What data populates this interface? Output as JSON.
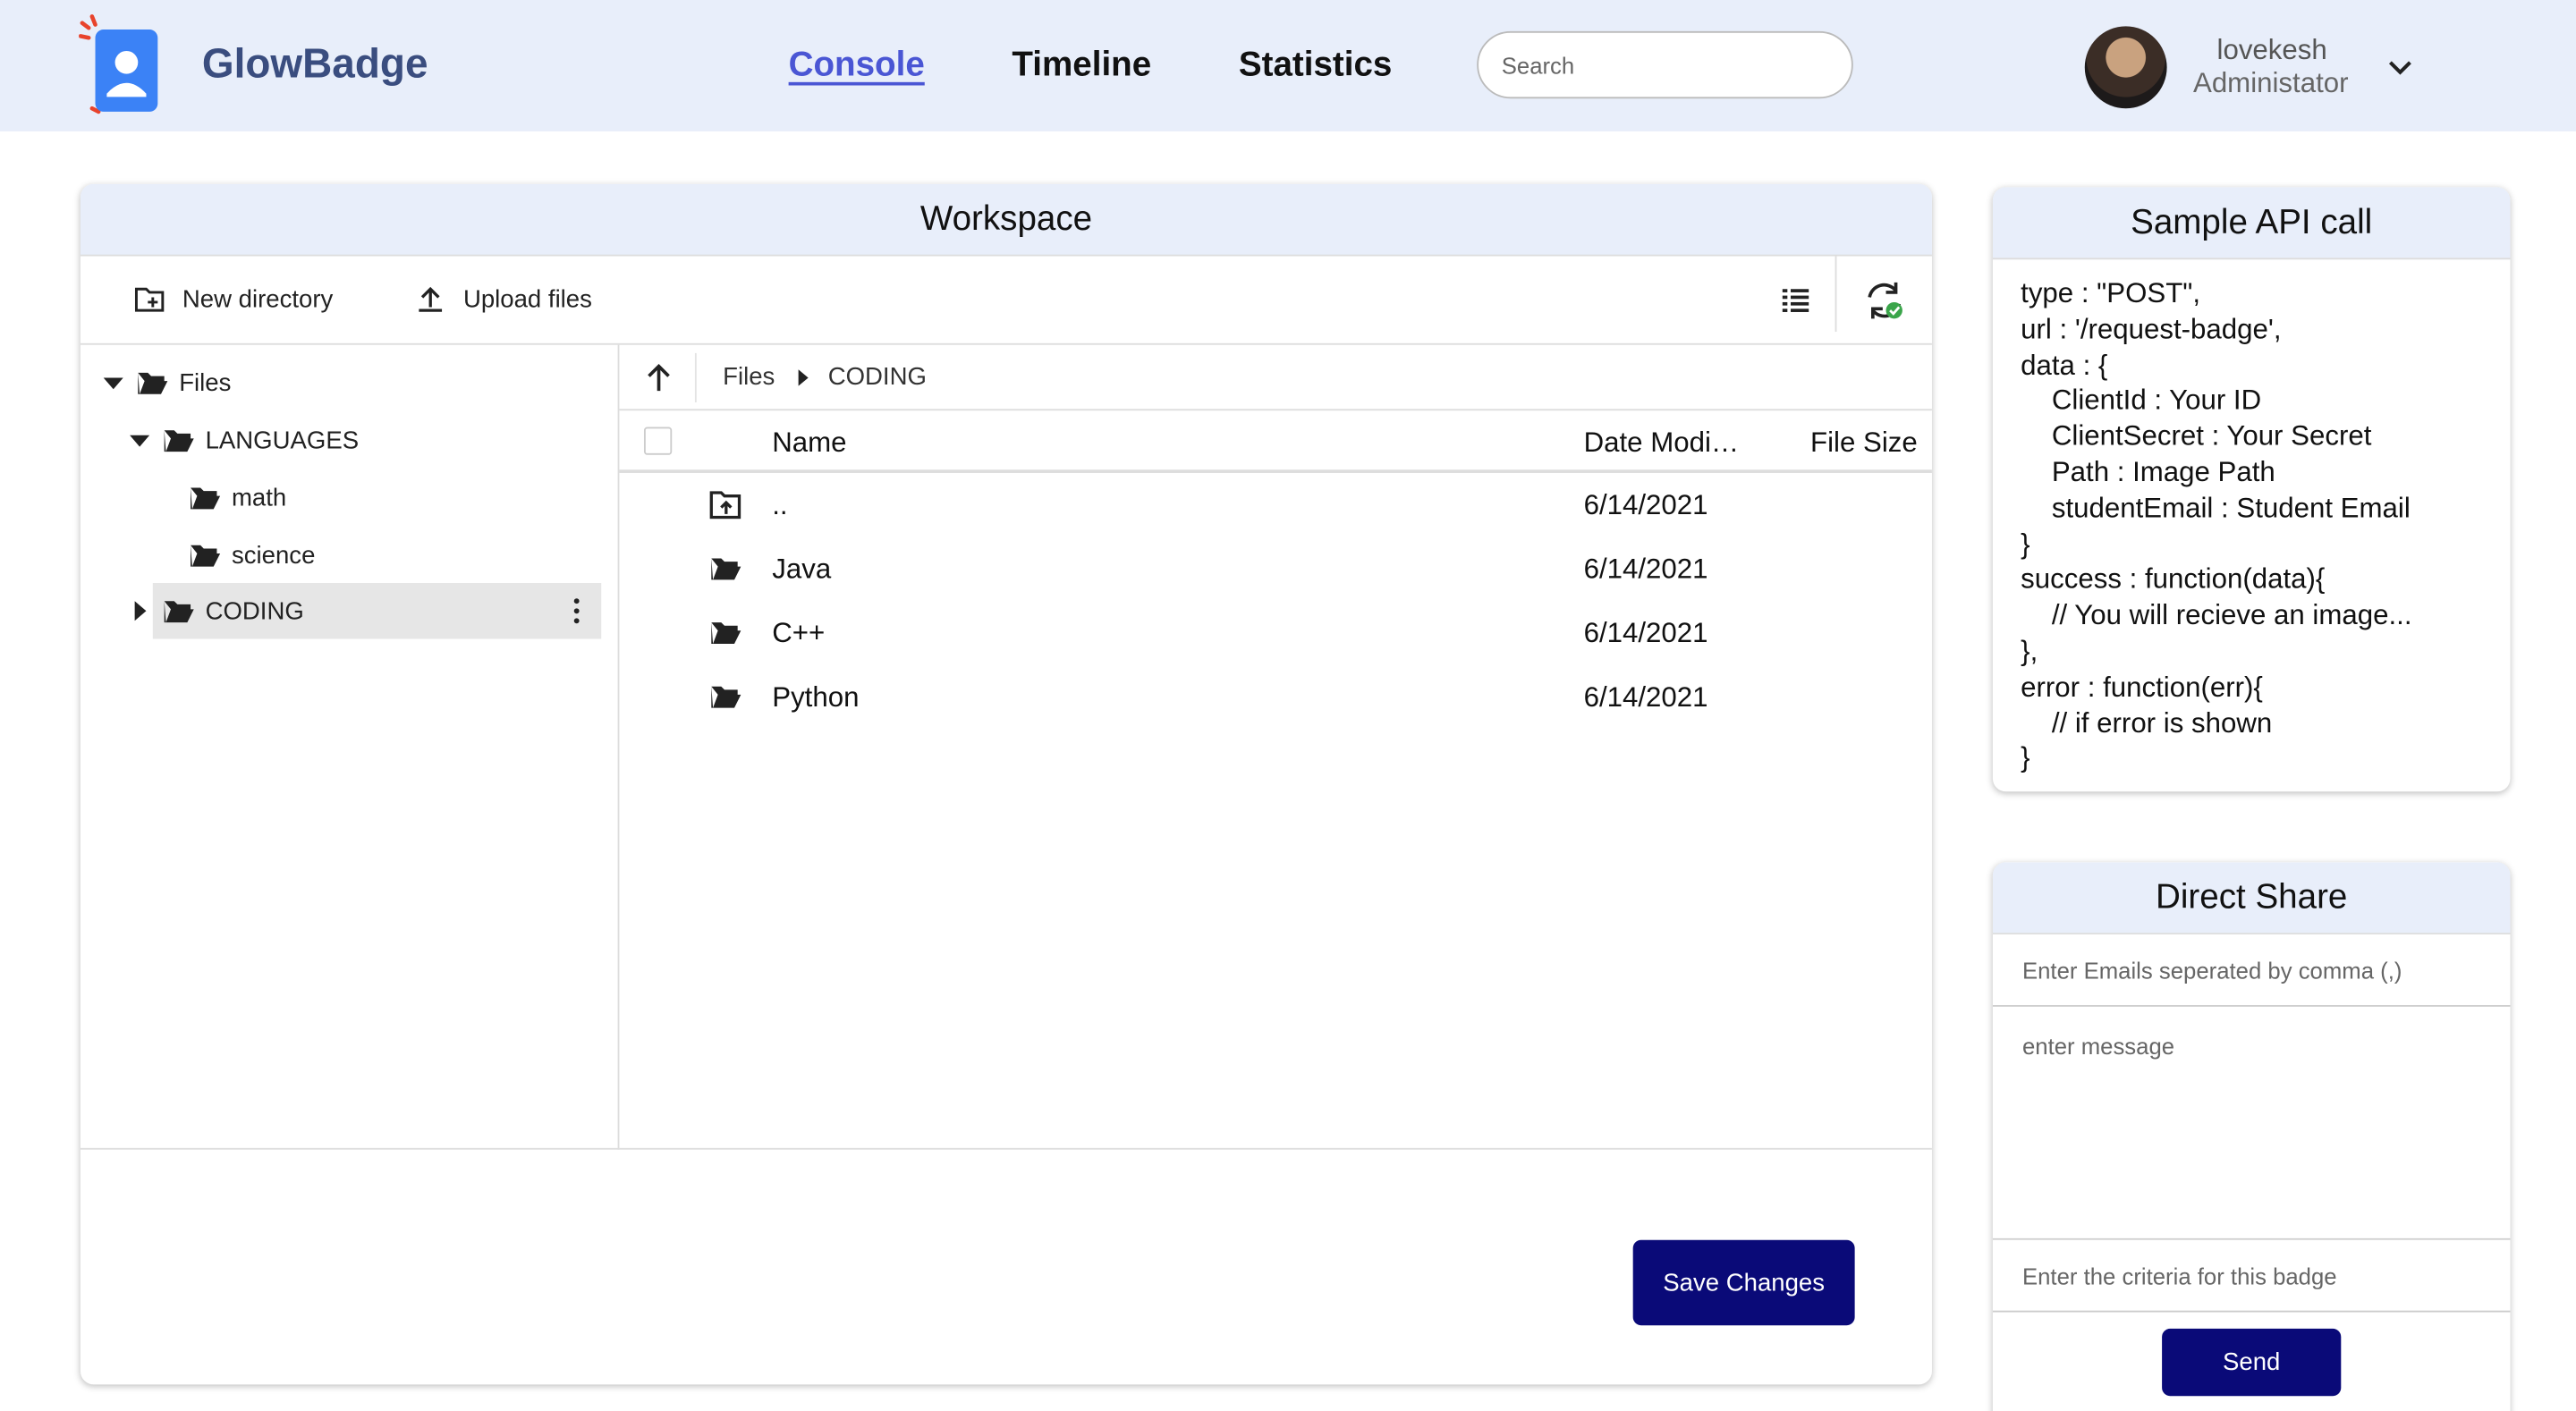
{
  "header": {
    "brand": "GlowBadge",
    "nav": [
      {
        "label": "Console",
        "active": true
      },
      {
        "label": "Timeline",
        "active": false
      },
      {
        "label": "Statistics",
        "active": false
      }
    ],
    "search_placeholder": "Search",
    "user": {
      "name": "lovekesh",
      "role": "Administator"
    }
  },
  "workspace": {
    "title": "Workspace",
    "toolbar": {
      "new_directory": "New directory",
      "upload_files": "Upload files"
    },
    "tree": {
      "root": "Files",
      "languages": "LANGUAGES",
      "math": "math",
      "science": "science",
      "coding": "CODING"
    },
    "breadcrumb": [
      "Files",
      "CODING"
    ],
    "columns": {
      "name": "Name",
      "date": "Date Modi…",
      "size": "File Size"
    },
    "rows": [
      {
        "name": "..",
        "date": "6/14/2021",
        "icon": "folder-up-icon"
      },
      {
        "name": "Java",
        "date": "6/14/2021",
        "icon": "folder-open-icon"
      },
      {
        "name": "C++",
        "date": "6/14/2021",
        "icon": "folder-open-icon"
      },
      {
        "name": "Python",
        "date": "6/14/2021",
        "icon": "folder-open-icon"
      }
    ],
    "save_label": "Save Changes"
  },
  "api": {
    "title": "Sample API call",
    "code": "type : \"POST\",\nurl : '/request-badge',\ndata : {\n    ClientId : Your ID\n    ClientSecret : Your Secret\n    Path : Image Path\n    studentEmail : Student Email\n}\nsuccess : function(data){\n    // You will recieve an image...\n},\nerror : function(err){\n    // if error is shown\n}"
  },
  "share": {
    "title": "Direct Share",
    "email_placeholder": "Enter Emails seperated by comma (,)",
    "message_placeholder": "enter message",
    "criteria_placeholder": "Enter the criteria for this badge",
    "send_label": "Send"
  },
  "colors": {
    "header_bg": "#e8eefa",
    "brand": "#3a4d7f",
    "nav_active": "#4a56d4",
    "button": "#0a0a78",
    "logo": "#3b82f6"
  }
}
